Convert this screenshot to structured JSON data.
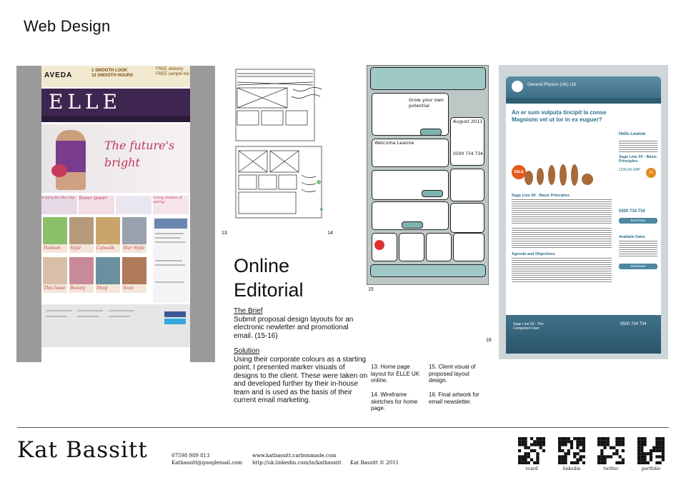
{
  "page": {
    "title": "Web Design"
  },
  "elle_screenshot": {
    "ad_brand": "AVEDA",
    "ad_line1": "1 SMOOTH LOOK",
    "ad_line2": "12 SMOOTH HOURS",
    "ad_right1": "FREE delivery",
    "ad_right2": "FREE sample trio",
    "logo": "ELLE",
    "hero_line1": "The future's",
    "hero_line2": "bright",
    "grid_captions": [
      "Fashion",
      "Style",
      "Catwalk",
      "Star Style",
      "This Issue",
      "Beauty",
      "Shop",
      "Scan"
    ],
    "strip_captions": [
      "A fairy for the city",
      "flower power",
      "Going shades of spring"
    ]
  },
  "sketch_numbers": {
    "left": "13",
    "right": "14"
  },
  "marker_visual": {
    "panel1": "Grow your own potential",
    "date": "August 2011",
    "welcome": "Welcome Leanne",
    "phone": "0500 734 734",
    "number": "15"
  },
  "email_artwork": {
    "company": "General Physics (UK) Ltd",
    "headline": "An er sum vulputa tincipit la conse Magnisim vel ut lor in ex euguer?",
    "greeting": "Hello Leanne",
    "course_title": "Sage Line 50 - Basic Principles",
    "price": "£236.00 GBP",
    "phone": "0500 734 734",
    "book_btn": "Book Now",
    "section_title": "Sage Line 50 - Basic Principles",
    "agenda_title": "Agenda and Objectives",
    "available_title": "Available Dates",
    "download_btn": "Download",
    "footer_course": "Sage Line 50 - The Competent User",
    "footer_phone": "0500 734 734",
    "number": "16",
    "sale_badge": "SALE",
    "badge_20": "20"
  },
  "editorial": {
    "title_line1": "Online",
    "title_line2": "Editorial",
    "brief_heading": "The Brief",
    "brief_text": "Submit proposal design layouts for an electronic newletter and promotional email. (15-16)",
    "solution_heading": "Solution",
    "solution_text": "Using their corporate colours as a starting point, I presented marker visuals of designs to the client. These were taken on and developed further by their in-house team and is used as the basis of their current email marketing."
  },
  "captions": {
    "c13": "13. Home page layout for ELLE UK online.",
    "c14": "14. Wireframe sketches for home page.",
    "c15": "15.  Client visual of proposed layout design.",
    "c16": "16. Final artwork for email newsletter."
  },
  "footer": {
    "name": "Kat Bassitt",
    "phone": "07598 989 813",
    "email": "Katbassitt@googlemail.com",
    "website": "www.katbassitt.carbonmade.com",
    "linkedin": "http://uk.linkedin.com/in/katbassitt",
    "copyright": "Kat Bassitt © 2011",
    "qr_labels": [
      "vcard",
      "linkedin",
      "twitter",
      "portfolio"
    ]
  }
}
